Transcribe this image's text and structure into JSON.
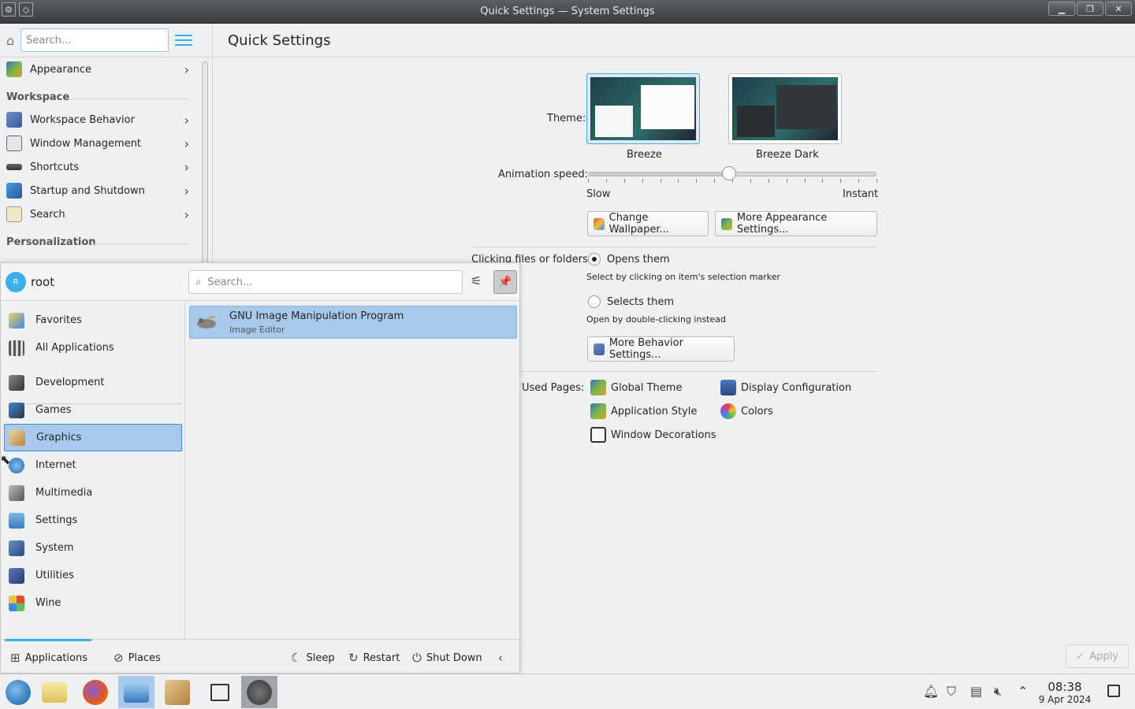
{
  "window": {
    "title": "Quick Settings — System Settings",
    "buttons": [
      "minimize",
      "maximize",
      "close"
    ]
  },
  "sidebar": {
    "search_placeholder": "Search...",
    "appearance": "Appearance",
    "workspace_heading": "Workspace",
    "items": [
      {
        "label": "Workspace Behavior",
        "icon": "workspace-behavior-icon"
      },
      {
        "label": "Window Management",
        "icon": "window-management-icon"
      },
      {
        "label": "Shortcuts",
        "icon": "shortcuts-icon"
      },
      {
        "label": "Startup and Shutdown",
        "icon": "startup-icon"
      },
      {
        "label": "Search",
        "icon": "search-icon"
      }
    ],
    "personalization_heading": "Personalization"
  },
  "main": {
    "page_title": "Quick Settings",
    "theme_label": "Theme:",
    "themes": [
      {
        "name": "Breeze",
        "selected": true
      },
      {
        "name": "Breeze Dark",
        "selected": false
      }
    ],
    "animation_label": "Animation speed:",
    "animation_slow": "Slow",
    "animation_instant": "Instant",
    "animation_value": 0.49,
    "change_wallpaper": "Change Wallpaper...",
    "more_appearance": "More Appearance Settings...",
    "clicking_label": "Clicking files or folders:",
    "opens_them": "Opens them",
    "opens_hint": "Select by clicking on item's selection marker",
    "selects_them": "Selects them",
    "selects_hint": "Open by double-clicking instead",
    "more_behavior": "More Behavior Settings...",
    "frequent_label": "Used Pages:",
    "frequent": [
      {
        "label": "Global Theme",
        "icon": "global-theme-icon"
      },
      {
        "label": "Display Configuration",
        "icon": "display-icon"
      },
      {
        "label": "Application Style",
        "icon": "app-style-icon"
      },
      {
        "label": "Colors",
        "icon": "colors-icon"
      },
      {
        "label": "Window Decorations",
        "icon": "window-decorations-icon"
      }
    ],
    "apply": "Apply"
  },
  "launcher": {
    "user_initial": "R",
    "user": "root",
    "search_placeholder": "Search...",
    "categories": [
      {
        "label": "Favorites"
      },
      {
        "label": "All Applications"
      },
      {
        "label": "Development"
      },
      {
        "label": "Games"
      },
      {
        "label": "Graphics",
        "selected": true
      },
      {
        "label": "Internet"
      },
      {
        "label": "Multimedia"
      },
      {
        "label": "Settings"
      },
      {
        "label": "System"
      },
      {
        "label": "Utilities"
      },
      {
        "label": "Wine"
      }
    ],
    "apps": [
      {
        "name": "GNU Image Manipulation Program",
        "desc": "Image Editor"
      }
    ],
    "footer": {
      "applications": "Applications",
      "places": "Places",
      "sleep": "Sleep",
      "restart": "Restart",
      "shutdown": "Shut Down"
    }
  },
  "taskbar": {
    "time": "08:38",
    "date": "9 Apr 2024"
  },
  "colors": {
    "accent": "#3daee9",
    "selection": "#a8c9ec"
  }
}
